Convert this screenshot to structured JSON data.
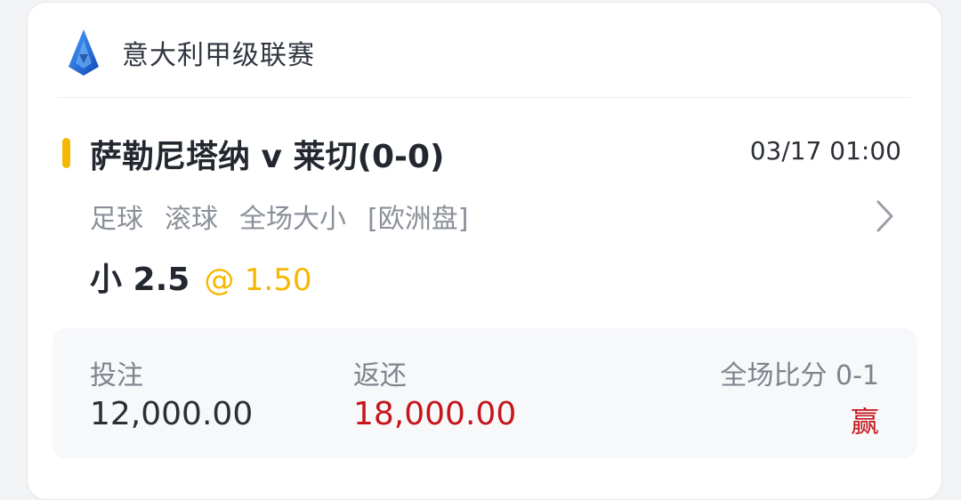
{
  "league": {
    "name": "意大利甲级联赛",
    "icon": "serie-a-logo-icon"
  },
  "match": {
    "title": "萨勒尼塔纳 v 莱切(0-0)",
    "time": "03/17 01:00"
  },
  "bet_type": {
    "sport": "足球",
    "mode": "滚球",
    "market": "全场大小",
    "odds_format": "[欧洲盘]"
  },
  "selection": {
    "pick": "小 2.5",
    "at": "@",
    "odds": "1.50"
  },
  "summary": {
    "stake_label": "投注",
    "stake_value": "12,000.00",
    "return_label": "返还",
    "return_value": "18,000.00",
    "score_text": "全场比分 0-1",
    "result": "赢"
  },
  "colors": {
    "accent": "#f5b800",
    "win": "#c4161c",
    "logo_blue": "#1f6fd6"
  }
}
